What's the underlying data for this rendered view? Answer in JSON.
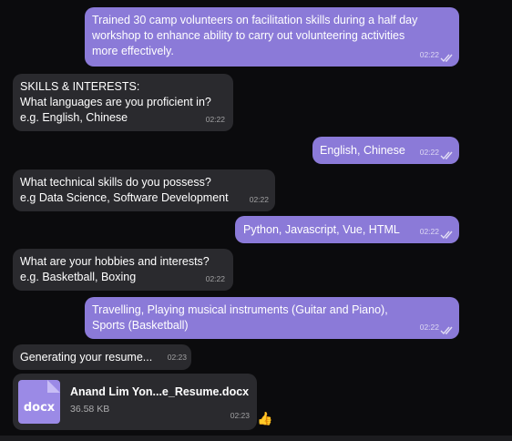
{
  "messages": [
    {
      "id": "m1",
      "text": "Trained 30 camp volunteers on facilitation skills during a half day\nworkshop to enhance ability to carry out volunteering activities\nmore effectively.",
      "time": "02:22"
    },
    {
      "id": "m2",
      "text": "SKILLS & INTERESTS:\nWhat languages are you proficient in?\ne.g. English, Chinese",
      "time": "02:22"
    },
    {
      "id": "m3",
      "text": "English, Chinese",
      "time": "02:22"
    },
    {
      "id": "m4",
      "text": "What technical skills do you possess?\ne.g Data Science, Software Development",
      "time": "02:22"
    },
    {
      "id": "m5",
      "text": "Python, Javascript, Vue, HTML",
      "time": "02:22"
    },
    {
      "id": "m6",
      "text": "What are your hobbies and interests?\ne.g. Basketball, Boxing",
      "time": "02:22"
    },
    {
      "id": "m7",
      "text": "Travelling, Playing musical instruments (Guitar and Piano),\nSports (Basketball)",
      "time": "02:22"
    },
    {
      "id": "m8",
      "text": "Generating your resume...",
      "time": "02:23"
    }
  ],
  "file": {
    "icon_label": "docx",
    "icon": "docx-file-icon",
    "name": "Anand Lim Yon...e_Resume.docx",
    "size": "36.58 KB",
    "time": "02:23",
    "reaction": "👍"
  },
  "colors": {
    "outgoing": "#8b7ad8",
    "incoming": "#2a2a2e",
    "background": "#0b0b0d"
  }
}
